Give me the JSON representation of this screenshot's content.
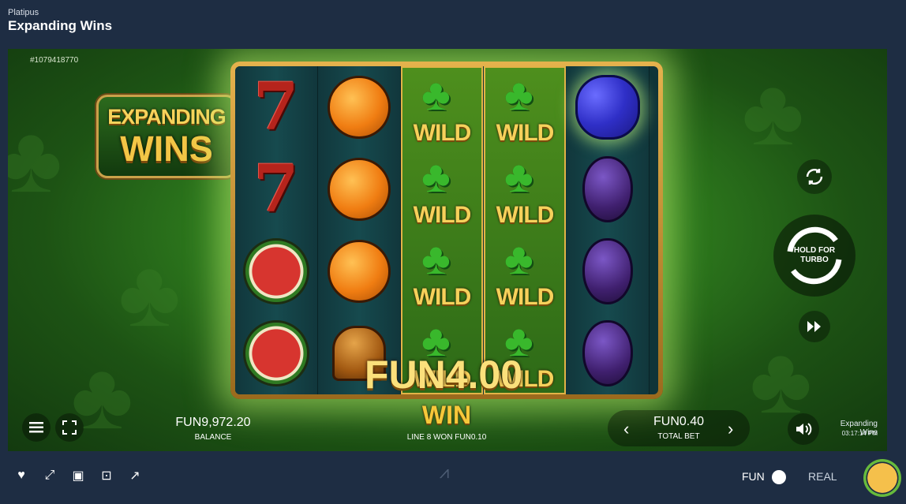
{
  "header": {
    "provider": "Platipus",
    "title": "Expanding Wins"
  },
  "game": {
    "spin_id": "#1079418770",
    "logo": {
      "line1": "EXPANDING",
      "line2": "WINS"
    },
    "reels": [
      [
        "seven",
        "seven",
        "watermelon",
        "watermelon"
      ],
      [
        "orange",
        "orange",
        "orange",
        "bell"
      ],
      [
        "wild",
        "wild",
        "wild",
        "wild"
      ],
      [
        "wild",
        "wild",
        "wild",
        "wild"
      ],
      [
        "grapes",
        "plum",
        "plum",
        "plum"
      ]
    ],
    "wild_label": "WILD",
    "seven_symbol": "7",
    "win": {
      "amount": "FUN4.00",
      "label": "WIN",
      "line_text": "LINE 8 WON FUN0.10"
    },
    "balance": {
      "value": "FUN9,972.20",
      "label": "BALANCE"
    },
    "bet": {
      "value": "FUN0.40",
      "label": "TOTAL BET",
      "prev": "‹",
      "next": "›"
    },
    "spin_button": {
      "line1": "HOLD FOR",
      "line2": "TURBO"
    },
    "clock": {
      "game": "Expanding Wins",
      "time": "03:17:14 PM"
    }
  },
  "footer": {
    "fun_label": "FUN",
    "real_label": "REAL"
  },
  "colors": {
    "accent_gold": "#f6d15b",
    "background": "#1e2d43",
    "green": "#2f7d1e"
  }
}
